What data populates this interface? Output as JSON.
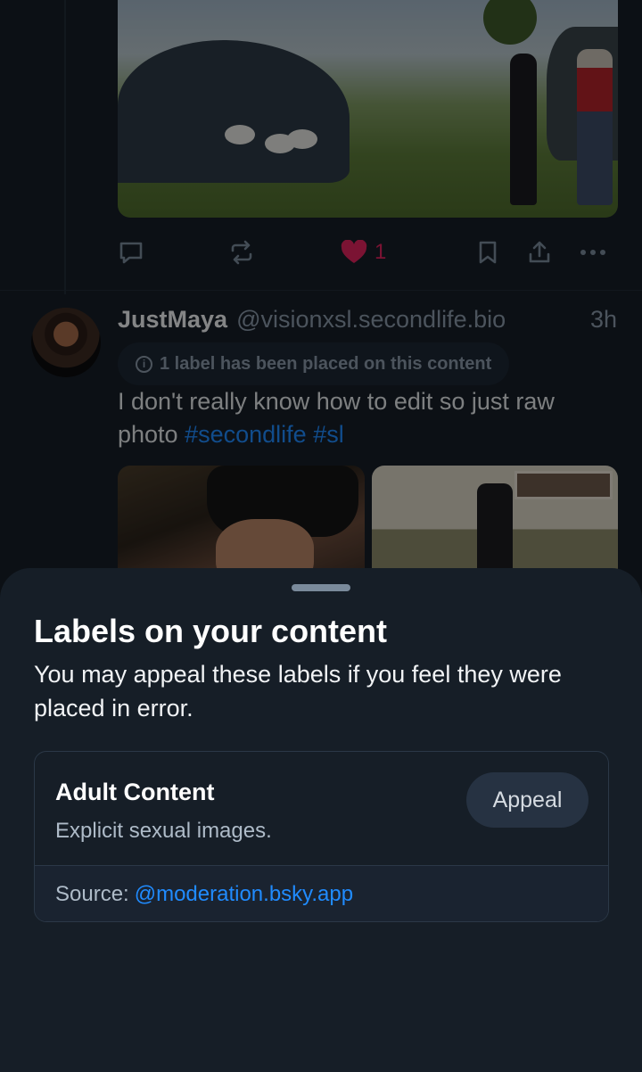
{
  "previous_post": {
    "like_count": "1"
  },
  "post": {
    "author_name": "JustMaya",
    "author_handle": "@visionxsl.secondlife.bio",
    "time_ago": "3h",
    "label_notice": "1 label has been placed on this content",
    "text_plain": "I don't really know how to edit so just raw photo",
    "hashtags": [
      "#secondlife",
      "#sl"
    ]
  },
  "sheet": {
    "title": "Labels on your content",
    "description": "You may appeal these labels if you feel they were placed in error.",
    "label": {
      "name": "Adult Content",
      "description": "Explicit sexual images.",
      "appeal_label": "Appeal",
      "source_prefix": "Source:",
      "source_handle": "@moderation.bsky.app"
    }
  },
  "colors": {
    "accent": "#208bfe",
    "like": "#e0245e",
    "sheet_bg": "#161e27"
  }
}
